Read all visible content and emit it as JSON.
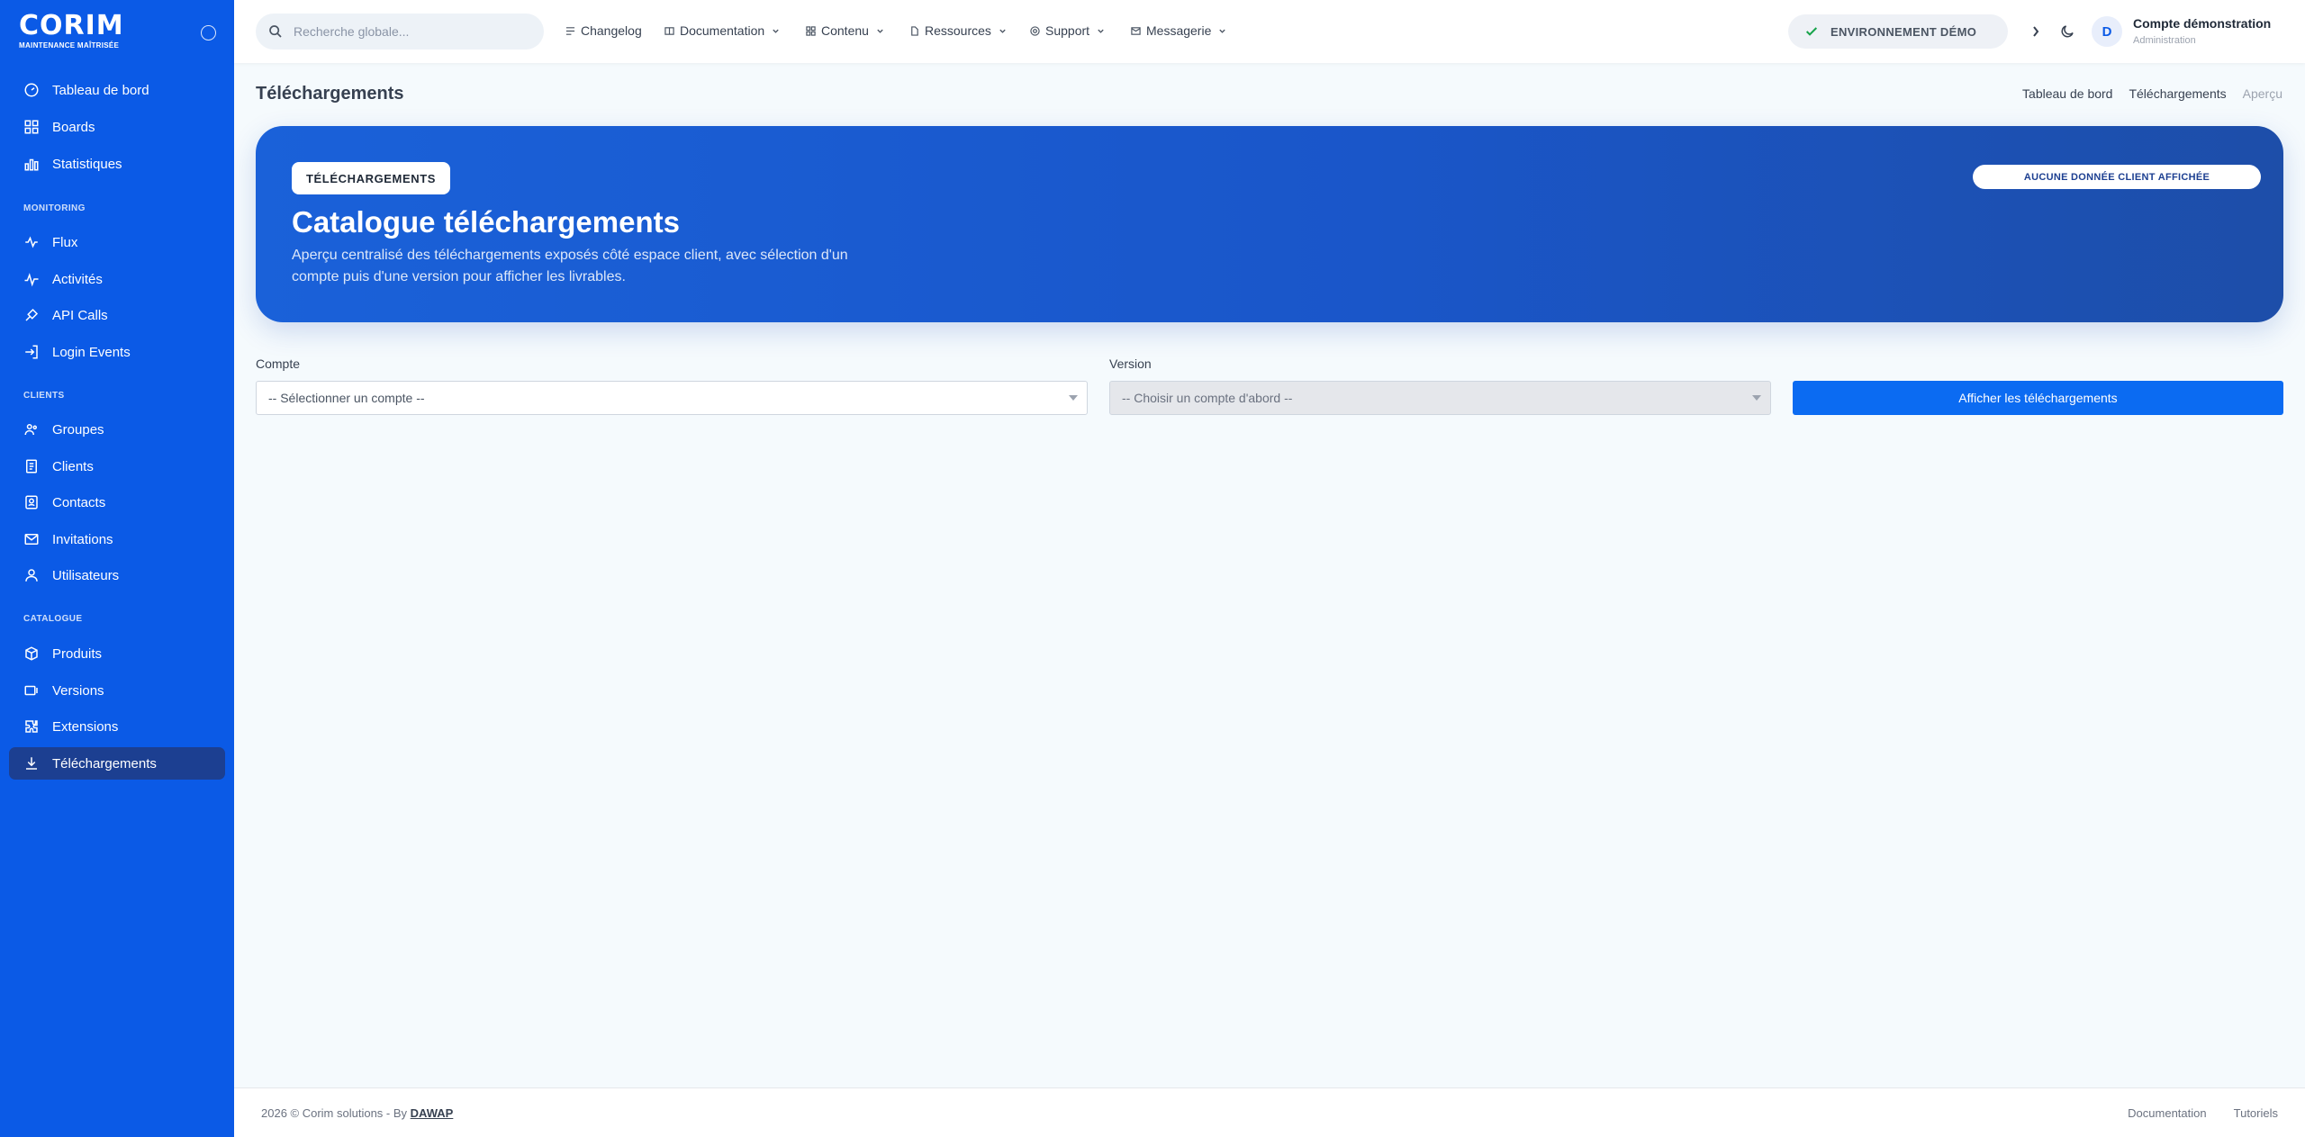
{
  "brand": {
    "logo_text": "CORIM",
    "tagline": "MAINTENANCE MAÎTRISÉE"
  },
  "sidebar": {
    "items": [
      {
        "label": "Tableau de bord",
        "icon": "dashboard-icon"
      },
      {
        "label": "Boards",
        "icon": "boards-icon"
      },
      {
        "label": "Statistiques",
        "icon": "chart-icon"
      }
    ],
    "sections": {
      "monitoring": "MONITORING",
      "clients": "CLIENTS",
      "catalogue": "CATALOGUE"
    },
    "monitoring_items": [
      {
        "label": "Flux",
        "icon": "flux-icon"
      },
      {
        "label": "Activités",
        "icon": "activity-icon"
      },
      {
        "label": "API Calls",
        "icon": "api-icon"
      },
      {
        "label": "Login Events",
        "icon": "login-icon"
      }
    ],
    "client_items": [
      {
        "label": "Groupes",
        "icon": "groups-icon"
      },
      {
        "label": "Clients",
        "icon": "clients-icon"
      },
      {
        "label": "Contacts",
        "icon": "contacts-icon"
      },
      {
        "label": "Invitations",
        "icon": "mail-icon"
      },
      {
        "label": "Utilisateurs",
        "icon": "users-icon"
      }
    ],
    "catalogue_items": [
      {
        "label": "Produits",
        "icon": "box-icon"
      },
      {
        "label": "Versions",
        "icon": "versions-icon"
      },
      {
        "label": "Extensions",
        "icon": "puzzle-icon"
      },
      {
        "label": "Téléchargements",
        "icon": "download-icon",
        "active": true
      }
    ]
  },
  "topbar": {
    "search_placeholder": "Recherche globale...",
    "nav": [
      {
        "label": "Changelog",
        "icon": "changelog-icon",
        "dropdown": false
      },
      {
        "label": "Documentation",
        "icon": "book-icon",
        "dropdown": true
      },
      {
        "label": "Contenu",
        "icon": "grid-icon",
        "dropdown": true
      },
      {
        "label": "Ressources",
        "icon": "resource-icon",
        "dropdown": true
      },
      {
        "label": "Support",
        "icon": "support-icon",
        "dropdown": true
      },
      {
        "label": "Messagerie",
        "icon": "message-icon",
        "dropdown": true
      }
    ],
    "env_badge": "ENVIRONNEMENT DÉMO",
    "avatar_letter": "D",
    "user_name": "Compte démonstration",
    "user_role": "Administration"
  },
  "page": {
    "title": "Téléchargements",
    "breadcrumb": [
      "Tableau de bord",
      "Téléchargements",
      "Aperçu"
    ]
  },
  "hero": {
    "chip": "TÉLÉCHARGEMENTS",
    "title": "Catalogue téléchargements",
    "description": "Aperçu centralisé des téléchargements exposés côté espace client, avec sélection d'un compte puis d'une version pour afficher les livrables.",
    "pill": "AUCUNE DONNÉE CLIENT AFFICHÉE"
  },
  "form": {
    "account_label": "Compte",
    "account_value": "-- Sélectionner un compte --",
    "version_label": "Version",
    "version_value": "-- Choisir un compte d'abord --",
    "submit_label": "Afficher les téléchargements"
  },
  "footer": {
    "copyright": "2026 © Corim solutions - By ",
    "by": "DAWAP",
    "links": [
      "Documentation",
      "Tutoriels"
    ]
  },
  "colors": {
    "sidebar_bg": "#0b5ae6",
    "active_item_bg": "#1c3f91",
    "primary_button": "#0b6bf2",
    "hero_gradient_start": "#1a61d9",
    "hero_gradient_end": "#1d4ea9"
  }
}
